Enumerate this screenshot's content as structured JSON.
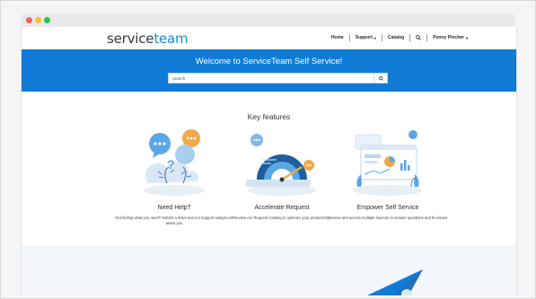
{
  "window": {
    "controls": [
      "close",
      "minimize",
      "maximize"
    ]
  },
  "brand": {
    "part1": "service",
    "part2": "team"
  },
  "nav": {
    "home": "Home",
    "support": "Support",
    "catalog": "Catalog",
    "user": "Penny Pincher"
  },
  "hero": {
    "title": "Welcome to ServiceTeam Self Service!",
    "search_placeholder": "Search"
  },
  "features": {
    "heading": "Key features",
    "items": [
      {
        "title": "Need Help?",
        "description": "Not finding what you need? Submit a ticket and our support analyst will assist you",
        "icon": "chat-bubbles-icon"
      },
      {
        "title": "Accelerate Request",
        "description": "Review our Request Catalog to optimize your productivity.",
        "icon": "speedometer-icon"
      },
      {
        "title": "Empower Self Service",
        "description": "Review and access multiple sources to answer questions and fix issues",
        "icon": "dashboard-icon"
      }
    ]
  },
  "colors": {
    "accent": "#0f7bd7",
    "brand_blue": "#1a8ad4",
    "illustration_blue": "#5aa7e6",
    "illustration_orange": "#f0a94a"
  }
}
